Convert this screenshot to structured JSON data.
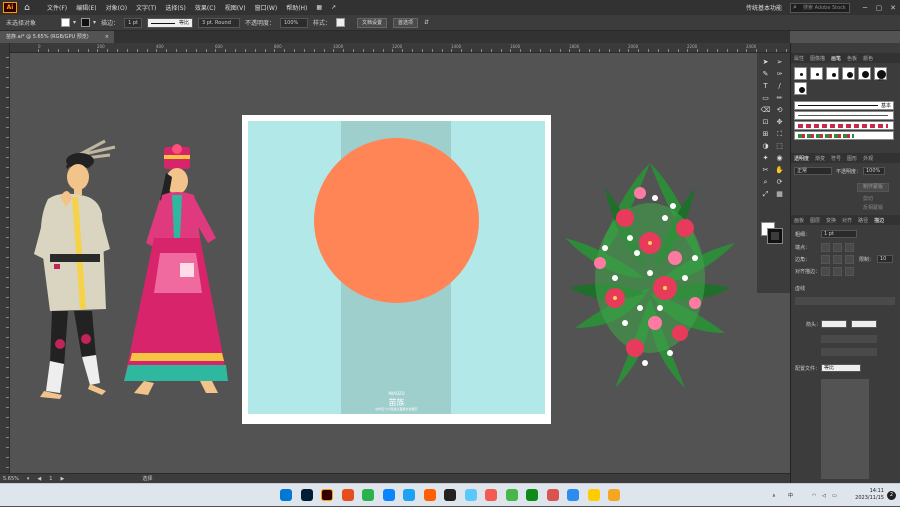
{
  "menubar": {
    "logo": "Ai",
    "items": [
      "文件(F)",
      "编辑(E)",
      "对象(O)",
      "文字(T)",
      "选择(S)",
      "效果(C)",
      "视图(V)",
      "窗口(W)",
      "帮助(H)"
    ],
    "workspace": "传统基本功能",
    "search_placeholder": "搜索 Adobe Stock"
  },
  "control_bar": {
    "selection_label": "未选择对象",
    "stroke_label": "描边：",
    "stroke_weight": "1 pt",
    "stroke_profile": "等比",
    "brush": "3 pt. Round",
    "opacity_label": "不透明度：",
    "opacity_value": "100%",
    "style_label": "样式：",
    "doc_setup_button": "文档设置",
    "prefs_button": "首选项"
  },
  "document_tab": {
    "title": "苗族.ai* @ 5.65% (RGB/GPU 预览)",
    "close": "×"
  },
  "ruler_labels": [
    "0",
    "200",
    "400",
    "600",
    "800",
    "1000",
    "1200",
    "1400",
    "1600",
    "1800",
    "2000",
    "2200",
    "2400"
  ],
  "poster": {
    "bg_color": "#b3e8e8",
    "strip_color": "#9fcfcc",
    "sun_color": "#ff8456",
    "small_top": "MIAOZU",
    "title": "苗族",
    "subtitle": "中华五十六民族之苗族文化展示"
  },
  "statusbar": {
    "zoom": "5.65%",
    "page": "1",
    "tool": "选择"
  },
  "panels": {
    "brushes_tabs": [
      "属性",
      "图像描",
      "画笔",
      "色板",
      "颜色"
    ],
    "brushes_active": "画笔",
    "brush_sizes": [
      "30"
    ],
    "brush_basic_label": "基本",
    "transparency_tabs": [
      "透明度",
      "渐变",
      "符号",
      "图形",
      "外观"
    ],
    "blend_mode": "正常",
    "opacity_label": "不透明度：",
    "opacity_value": "100%",
    "make_mask_button": "制作蒙版",
    "clip_label": "剪切",
    "invert_label": "反相蒙版",
    "stroke_tabs": [
      "画板",
      "图层",
      "变换",
      "对齐",
      "路径",
      "描边"
    ],
    "weight_label": "粗细：",
    "weight_value": "1 pt",
    "cap_label": "端点：",
    "corner_label": "边角：",
    "limit_label": "限制：",
    "limit_value": "10",
    "align_label": "对齐描边：",
    "dashed_label": "虚线",
    "arrow_label": "箭头：",
    "profile_label": "配置文件：",
    "profile_value": "等比"
  },
  "taskbar": {
    "ime": "中",
    "time": "14:11",
    "date": "2023/11/15",
    "notifications": "2",
    "app_colors": [
      "#0078d4",
      "#001e36",
      "#330000",
      "#e84e1b",
      "#2bb24c",
      "#0a84ff",
      "#1da1f2",
      "#ff5f00",
      "#222222",
      "#5ac8fa",
      "#f25c54",
      "#48b749",
      "#0e8a16",
      "#d9534f",
      "#2d8cf0",
      "#ffcc00",
      "#f5a623"
    ]
  }
}
